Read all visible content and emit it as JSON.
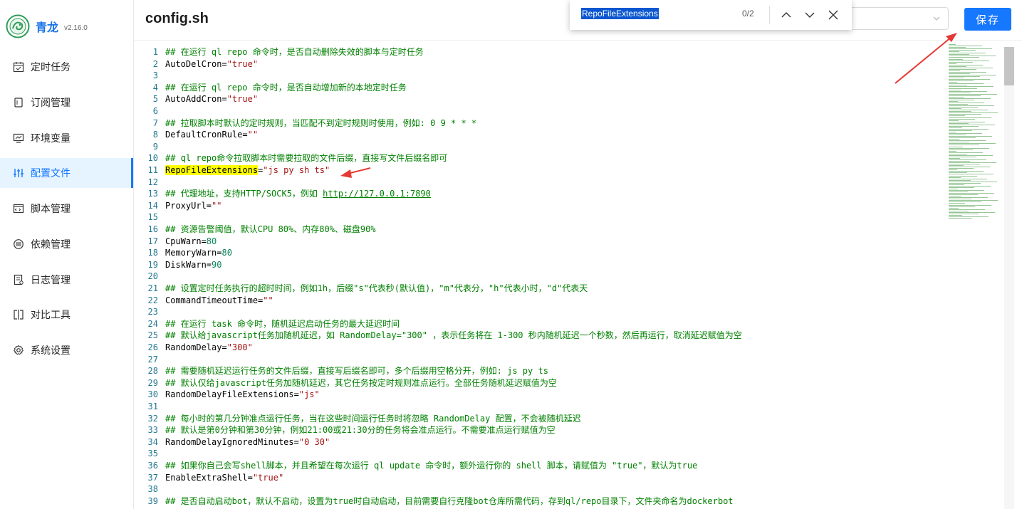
{
  "app": {
    "name": "青龙",
    "version": "v2.16.0"
  },
  "sidebar": {
    "items": [
      {
        "label": "定时任务",
        "icon": "calendar-icon"
      },
      {
        "label": "订阅管理",
        "icon": "subscription-icon"
      },
      {
        "label": "环境变量",
        "icon": "monitor-icon"
      },
      {
        "label": "配置文件",
        "icon": "sliders-icon",
        "active": true
      },
      {
        "label": "脚本管理",
        "icon": "code-file-icon"
      },
      {
        "label": "依赖管理",
        "icon": "package-icon"
      },
      {
        "label": "日志管理",
        "icon": "log-icon"
      },
      {
        "label": "对比工具",
        "icon": "diff-icon"
      },
      {
        "label": "系统设置",
        "icon": "gear-icon"
      }
    ]
  },
  "header": {
    "title": "config.sh",
    "save_label": "保存"
  },
  "find": {
    "query": "RepoFileExtensions",
    "count": "0/2"
  },
  "colors": {
    "accent": "#1677ff",
    "comment": "#008000",
    "string": "#a31515",
    "number": "#098658",
    "highlight": "#ffff00",
    "annotation": "#e53935"
  },
  "editor": {
    "lines": [
      {
        "n": "1",
        "segs": [
          {
            "t": "## 在运行 ql repo 命令时，是否自动删除失效的脚本与定时任务",
            "c": "comment"
          }
        ]
      },
      {
        "n": "2",
        "segs": [
          {
            "t": "AutoDelCron="
          },
          {
            "t": "\"true\"",
            "c": "str"
          }
        ]
      },
      {
        "n": "3",
        "segs": []
      },
      {
        "n": "4",
        "segs": [
          {
            "t": "## 在运行 ql repo 命令时，是否自动增加新的本地定时任务",
            "c": "comment"
          }
        ]
      },
      {
        "n": "5",
        "segs": [
          {
            "t": "AutoAddCron="
          },
          {
            "t": "\"true\"",
            "c": "str"
          }
        ]
      },
      {
        "n": "6",
        "segs": []
      },
      {
        "n": "7",
        "segs": [
          {
            "t": "## 拉取脚本时默认的定时规则，当匹配不到定时规则时使用，例如: 0 9 * * *",
            "c": "comment"
          }
        ]
      },
      {
        "n": "8",
        "segs": [
          {
            "t": "DefaultCronRule="
          },
          {
            "t": "\"\"",
            "c": "str"
          }
        ]
      },
      {
        "n": "9",
        "segs": []
      },
      {
        "n": "10",
        "segs": [
          {
            "t": "## ql repo命令拉取脚本时需要拉取的文件后缀，直接写文件后缀名即可",
            "c": "comment"
          }
        ]
      },
      {
        "n": "11",
        "segs": [
          {
            "t": "RepoFileExtensions",
            "c": "hl"
          },
          {
            "t": "="
          },
          {
            "t": "\"js py sh ts\"",
            "c": "str"
          }
        ]
      },
      {
        "n": "12",
        "segs": []
      },
      {
        "n": "13",
        "segs": [
          {
            "t": "## 代理地址，支持HTTP/SOCK5，例如 ",
            "c": "comment"
          },
          {
            "t": "http://127.0.0.1:7890",
            "c": "comment link"
          }
        ]
      },
      {
        "n": "14",
        "segs": [
          {
            "t": "ProxyUrl="
          },
          {
            "t": "\"\"",
            "c": "str"
          }
        ]
      },
      {
        "n": "15",
        "segs": []
      },
      {
        "n": "16",
        "segs": [
          {
            "t": "## 资源告警阈值，默认CPU 80%、内存80%、磁盘90%",
            "c": "comment"
          }
        ]
      },
      {
        "n": "17",
        "segs": [
          {
            "t": "CpuWarn="
          },
          {
            "t": "80",
            "c": "num"
          }
        ]
      },
      {
        "n": "18",
        "segs": [
          {
            "t": "MemoryWarn="
          },
          {
            "t": "80",
            "c": "num"
          }
        ]
      },
      {
        "n": "19",
        "segs": [
          {
            "t": "DiskWarn="
          },
          {
            "t": "90",
            "c": "num"
          }
        ]
      },
      {
        "n": "20",
        "segs": []
      },
      {
        "n": "21",
        "segs": [
          {
            "t": "## 设置定时任务执行的超时时间，例如1h，后缀\"s\"代表秒(默认值)，\"m\"代表分，\"h\"代表小时，\"d\"代表天",
            "c": "comment"
          }
        ]
      },
      {
        "n": "22",
        "segs": [
          {
            "t": "CommandTimeoutTime="
          },
          {
            "t": "\"\"",
            "c": "str"
          }
        ]
      },
      {
        "n": "23",
        "segs": []
      },
      {
        "n": "24",
        "segs": [
          {
            "t": "## 在运行 task 命令时，随机延迟启动任务的最大延迟时间",
            "c": "comment"
          }
        ]
      },
      {
        "n": "25",
        "segs": [
          {
            "t": "## 默认给javascript任务加随机延迟，如 RandomDelay=\"300\" ，表示任务将在 1-300 秒内随机延迟一个秒数，然后再运行，取消延迟赋值为空",
            "c": "comment"
          }
        ]
      },
      {
        "n": "26",
        "segs": [
          {
            "t": "RandomDelay="
          },
          {
            "t": "\"300\"",
            "c": "str"
          }
        ]
      },
      {
        "n": "27",
        "segs": []
      },
      {
        "n": "28",
        "segs": [
          {
            "t": "## 需要随机延迟运行任务的文件后缀，直接写后缀名即可，多个后缀用空格分开，例如: js py ts",
            "c": "comment"
          }
        ]
      },
      {
        "n": "29",
        "segs": [
          {
            "t": "## 默认仅给javascript任务加随机延迟，其它任务按定时规则准点运行。全部任务随机延迟赋值为空",
            "c": "comment"
          }
        ]
      },
      {
        "n": "30",
        "segs": [
          {
            "t": "RandomDelayFileExtensions="
          },
          {
            "t": "\"js\"",
            "c": "str"
          }
        ]
      },
      {
        "n": "31",
        "segs": []
      },
      {
        "n": "32",
        "segs": [
          {
            "t": "## 每小时的第几分钟准点运行任务，当在这些时间运行任务时将忽略 RandomDelay 配置，不会被随机延迟",
            "c": "comment"
          }
        ]
      },
      {
        "n": "33",
        "segs": [
          {
            "t": "## 默认是第0分钟和第30分钟，例如21:00或21:30分的任务将会准点运行。不需要准点运行赋值为空",
            "c": "comment"
          }
        ]
      },
      {
        "n": "34",
        "segs": [
          {
            "t": "RandomDelayIgnoredMinutes="
          },
          {
            "t": "\"0 30\"",
            "c": "str"
          }
        ]
      },
      {
        "n": "35",
        "segs": []
      },
      {
        "n": "36",
        "segs": [
          {
            "t": "## 如果你自己会写shell脚本，并且希望在每次运行 ql update 命令时，额外运行你的 shell 脚本，请赋值为 \"true\"，默认为true",
            "c": "comment"
          }
        ]
      },
      {
        "n": "37",
        "segs": [
          {
            "t": "EnableExtraShell="
          },
          {
            "t": "\"true\"",
            "c": "str"
          }
        ]
      },
      {
        "n": "38",
        "segs": []
      },
      {
        "n": "39",
        "segs": [
          {
            "t": "## 是否自动启动bot，默认不启动，设置为true时自动启动，目前需要自行克隆bot仓库所需代码，存到ql/repo目录下，文件夹命名为dockerbot",
            "c": "comment"
          }
        ]
      }
    ]
  }
}
